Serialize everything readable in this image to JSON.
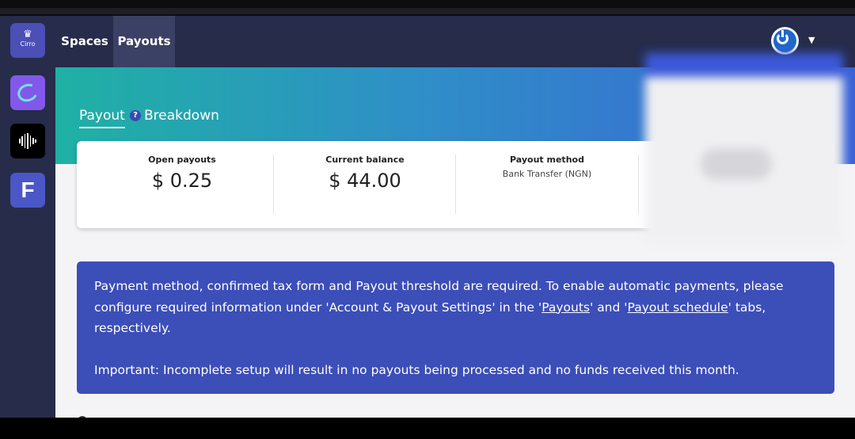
{
  "logo": {
    "text": "Cirro",
    "crown": "♛"
  },
  "nav": {
    "spaces": "Spaces",
    "payouts": "Payouts"
  },
  "user": {
    "caret": "▼"
  },
  "side_apps": {
    "third_letter": "F"
  },
  "tabs": {
    "payout": "Payout",
    "help": "?",
    "breakdown": "Breakdown"
  },
  "stats": {
    "open_payouts": {
      "label": "Open payouts",
      "value": "$ 0.25"
    },
    "current_balance": {
      "label": "Current balance",
      "value": "$ 44.00"
    },
    "payout_method": {
      "label": "Payout method",
      "value": "Bank Transfer (NGN)"
    }
  },
  "alert": {
    "line1_pre": "Payment method, confirmed tax form and Payout threshold are required. To enable automatic payments, please configure required information under 'Account & Payout Settings' in the '",
    "link1": "Payouts",
    "mid": "' and '",
    "link2": "Payout schedule",
    "line1_post": "' tabs, respectively.",
    "important": "Important: Incomplete setup will result in no payouts being processed and no funds received this month."
  }
}
